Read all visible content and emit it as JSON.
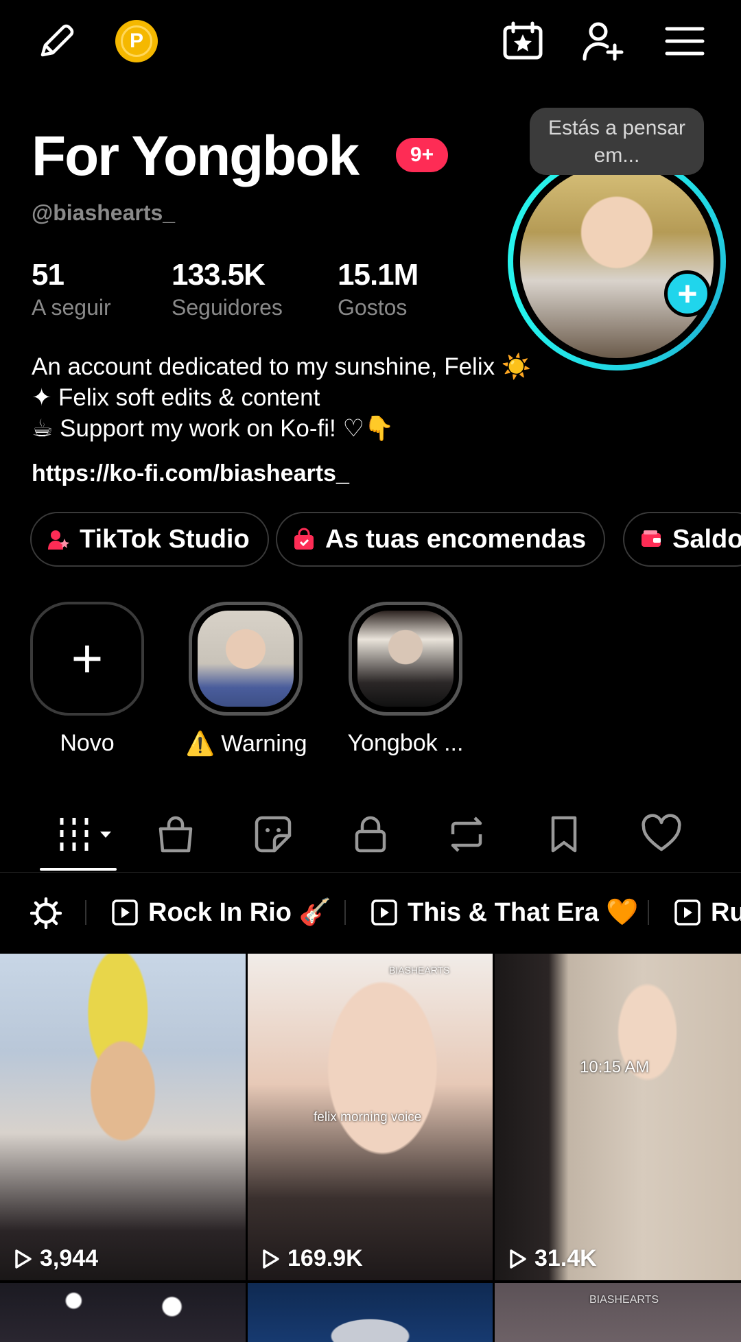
{
  "topbar": {
    "icons": [
      "edit-pencil-icon",
      "coin-icon",
      "calendar-star-icon",
      "add-friend-icon",
      "menu-icon"
    ],
    "coin_letter": "P"
  },
  "profile": {
    "name": "For Yongbok",
    "notif_badge": "9+",
    "handle": "@biashearts_",
    "thought_bubble": "Estás a pensar em...",
    "stats": [
      {
        "value": "51",
        "label": "A seguir"
      },
      {
        "value": "133.5K",
        "label": "Seguidores"
      },
      {
        "value": "15.1M",
        "label": "Gostos"
      }
    ],
    "bio_lines": [
      "An account dedicated to my sunshine, Felix ☀️",
      "✦ Felix soft edits & content",
      "☕ Support my work on Ko-fi! ♡👇"
    ],
    "link": "https://ko-fi.com/biashearts_"
  },
  "pills": [
    {
      "label": "TikTok Studio",
      "icon": "studio-icon"
    },
    {
      "label": "As tuas encomendas",
      "icon": "shopping-bag-icon"
    },
    {
      "label": "Saldo",
      "icon": "wallet-icon"
    }
  ],
  "highlights": [
    {
      "label": "Novo"
    },
    {
      "label": "⚠️ Warning"
    },
    {
      "label": "Yongbok ..."
    }
  ],
  "tabs": [
    "videos-grid-icon",
    "shop-bag-icon",
    "sticker-icon",
    "lock-icon",
    "repost-icon",
    "bookmark-icon",
    "heart-icon"
  ],
  "playlists": [
    {
      "label": "Rock In Rio 🎸"
    },
    {
      "label": "This & That Era 🧡"
    },
    {
      "label": "Ru"
    }
  ],
  "videos": [
    {
      "views": "3,944",
      "overlay": ""
    },
    {
      "views": "169.9K",
      "overlay": "felix morning voice",
      "watermark": "BIASHEARTS"
    },
    {
      "views": "31.4K",
      "overlay": "10:15 AM"
    },
    {
      "views": "",
      "overlay": ""
    },
    {
      "views": "",
      "overlay": ""
    },
    {
      "views": "",
      "overlay": "",
      "watermark": "BIASHEARTS"
    }
  ],
  "colors": {
    "accent_red": "#fe2c55",
    "accent_cyan": "#20d5ec",
    "coin": "#f5b800",
    "muted_text": "#8a8a8a"
  }
}
